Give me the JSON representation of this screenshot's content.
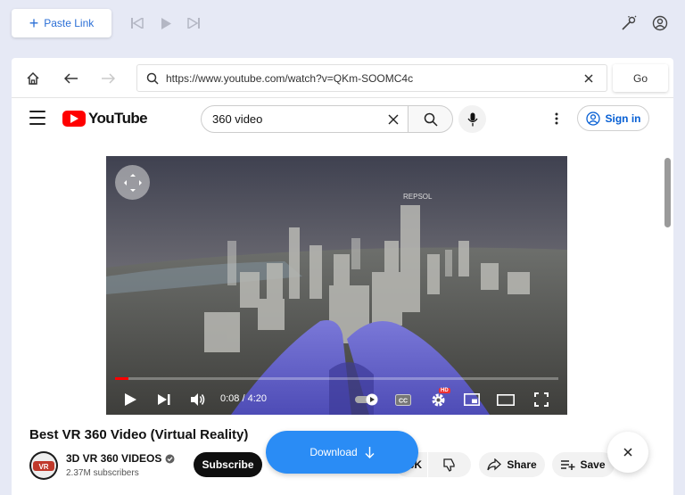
{
  "toolbar": {
    "paste_link_label": "Paste Link"
  },
  "browser": {
    "url": "https://www.youtube.com/watch?v=QKm-SOOMC4c",
    "go_label": "Go"
  },
  "youtube": {
    "logo_text": "YouTube",
    "search_query": "360 video",
    "signin_label": "Sign in",
    "overlay_text": "REPSOL"
  },
  "player": {
    "current_time": "0:08",
    "duration": "4:20",
    "time_display": "0:08 / 4:20",
    "hd_badge": "HD",
    "cc_label": "CC",
    "progress_fraction": 0.031
  },
  "video": {
    "title": "Best VR 360 Video (Virtual Reality)",
    "channel_name": "3D VR 360 VIDEOS",
    "channel_avatar_text": "VR",
    "subscriber_count": "2.37M subscribers",
    "subscribe_label": "Subscribe",
    "like_count_visible": "3K",
    "share_label": "Share",
    "save_label": "Save"
  },
  "overlay": {
    "download_label": "Download"
  },
  "colors": {
    "accent_blue": "#2b6fd6",
    "download_blue": "#2a8cf5",
    "youtube_red": "#ff0000",
    "signin_blue": "#065fd4"
  }
}
